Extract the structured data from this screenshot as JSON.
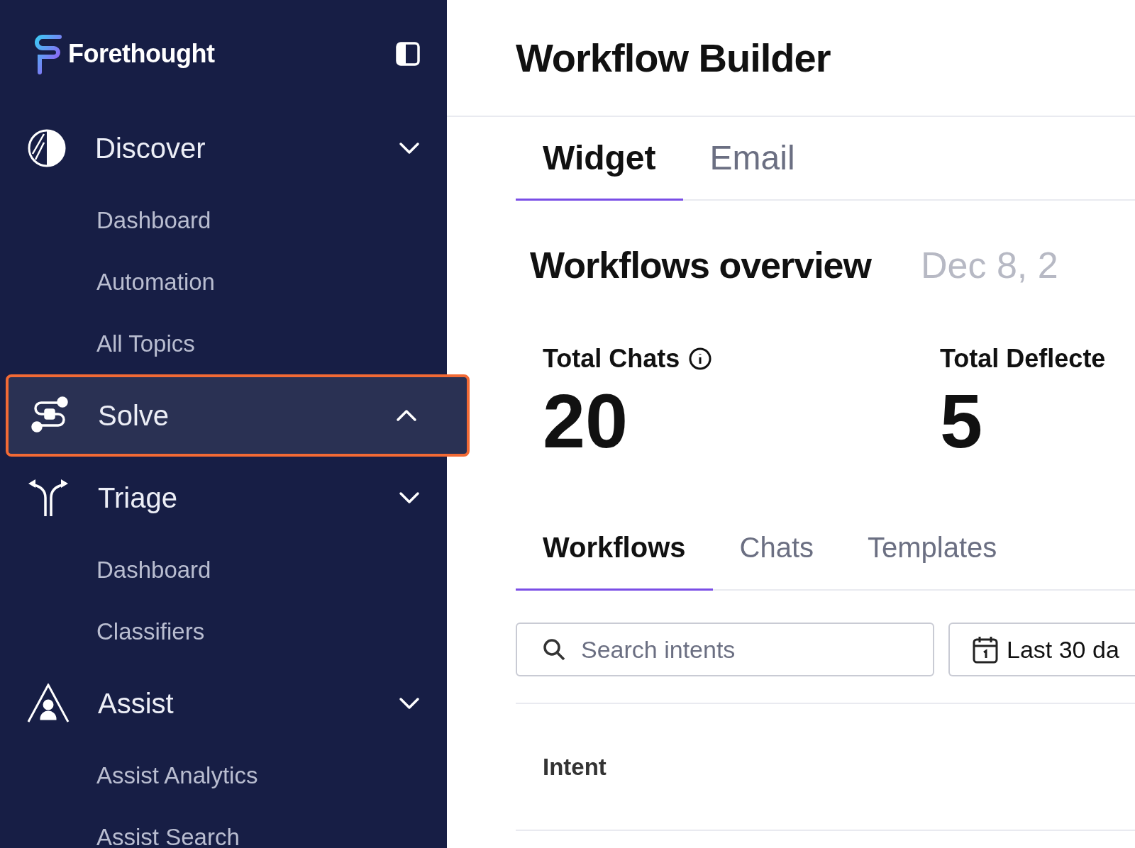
{
  "sidebar": {
    "brand": "Forethought",
    "sections": [
      {
        "label": "Discover",
        "expanded": false,
        "selected": false,
        "children": [
          {
            "label": "Dashboard"
          },
          {
            "label": "Automation"
          },
          {
            "label": "All Topics"
          }
        ]
      },
      {
        "label": "Solve",
        "expanded": true,
        "selected": true
      },
      {
        "label": "Triage",
        "expanded": false,
        "selected": false,
        "children": [
          {
            "label": "Dashboard"
          },
          {
            "label": "Classifiers"
          }
        ]
      },
      {
        "label": "Assist",
        "expanded": false,
        "selected": false,
        "children": [
          {
            "label": "Assist Analytics"
          },
          {
            "label": "Assist Search"
          }
        ]
      }
    ]
  },
  "header": {
    "title": "Workflow Builder"
  },
  "channel_tabs": [
    {
      "label": "Widget",
      "selected": true
    },
    {
      "label": "Email",
      "selected": false
    }
  ],
  "overview": {
    "title": "Workflows overview",
    "date": "Dec 8, 2"
  },
  "stats": [
    {
      "label": "Total Chats",
      "value": "20"
    },
    {
      "label": "Total Deflecte",
      "value": "5"
    }
  ],
  "list_tabs": [
    {
      "label": "Workflows",
      "selected": true
    },
    {
      "label": "Chats",
      "selected": false
    },
    {
      "label": "Templates",
      "selected": false
    }
  ],
  "search": {
    "placeholder": "Search intents"
  },
  "date_range": {
    "label": "Last 30 da"
  },
  "table": {
    "columns": [
      "Intent"
    ]
  }
}
